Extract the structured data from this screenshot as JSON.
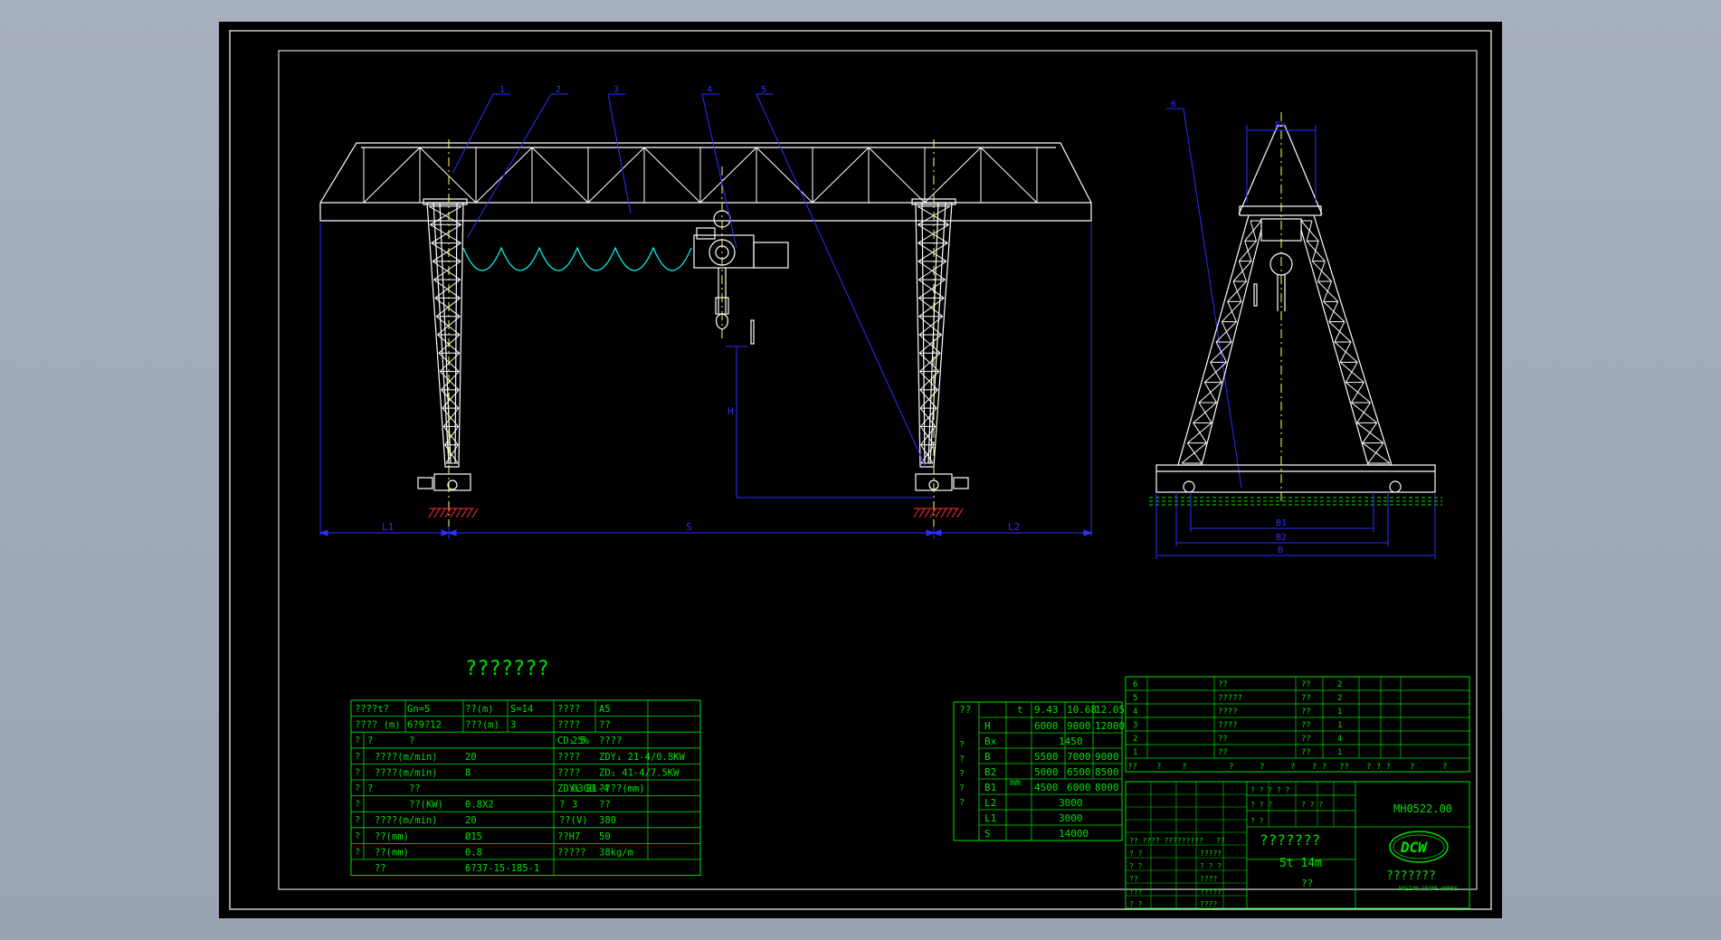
{
  "drawing": {
    "main_title": "???????",
    "part_number": "MH0522.00",
    "name": "???????",
    "spec": "5t  14m",
    "material": "??",
    "scale": "???????",
    "company_sub": "DALIAN CRANE WORKS",
    "logo_text": "DCW"
  },
  "balloons": [
    "1",
    "2",
    "3",
    "4",
    "5",
    "6"
  ],
  "dimensions": {
    "l1": "L1",
    "span": "S",
    "l2": "L2",
    "height": "H",
    "bx": "Bx",
    "b1": "B1",
    "b2": "B2",
    "b": "B"
  },
  "params": {
    "rows": [
      [
        "????t?",
        "Gn=5",
        "??(m)",
        "S=14",
        "????",
        "A5"
      ],
      [
        "???? (m)",
        "6?9?12",
        "???(m)",
        "3",
        "????",
        "??"
      ],
      [
        "?",
        "?",
        "CD₁ 5",
        "????",
        "25%"
      ],
      [
        "????(m/min)",
        "20",
        "????",
        "ZDY₁ 21-4/0.8KW"
      ],
      [
        "????(m/min)",
        "8",
        "????",
        "ZD₁ 41-4/7.5KW"
      ],
      [
        "?",
        "??",
        "ZDY₁ 21-4",
        "????(mm)",
        "Ø300"
      ],
      [
        "??(KW)",
        "0.8X2",
        "?",
        "??",
        "3"
      ],
      [
        "????(m/min)",
        "20",
        "??(V)",
        "380"
      ],
      [
        "??(mm)",
        "Ø15",
        "??H7",
        "50"
      ],
      [
        "??(mm)",
        "0.8",
        "?????",
        "38kg/m"
      ],
      [
        "??",
        "6?37-15-185-1"
      ]
    ],
    "side_labels": [
      "?",
      "?",
      "?",
      "?",
      "?",
      "?",
      "?",
      "?"
    ]
  },
  "dimtable": {
    "header": [
      "??",
      "t",
      "9.43",
      "10.68",
      "12.05"
    ],
    "side": "?????",
    "unit": "mm",
    "rows": [
      [
        "H",
        "6000",
        "9000",
        "12000"
      ],
      [
        "Bx",
        "1450"
      ],
      [
        "B",
        "5500",
        "7000",
        "9000"
      ],
      [
        "B2",
        "5000",
        "6500",
        "8500"
      ],
      [
        "B1",
        "4500",
        "6000",
        "8000"
      ],
      [
        "L2",
        "3000"
      ],
      [
        "L1",
        "3000"
      ],
      [
        "S",
        "14000"
      ]
    ]
  },
  "parts": [
    [
      "6",
      "??",
      "??",
      "2"
    ],
    [
      "5",
      "?????",
      "??",
      "2"
    ],
    [
      "4",
      "????",
      "??",
      "1"
    ],
    [
      "3",
      "????",
      "??",
      "1"
    ],
    [
      "2",
      "??",
      "??",
      "4"
    ],
    [
      "1",
      "??",
      "??",
      "1"
    ]
  ],
  "parts_header": [
    "??",
    "?",
    "?",
    "?",
    "?",
    "?",
    "? ?",
    "??",
    "? ? ?",
    "?",
    "?"
  ],
  "titleblock": {
    "left_rows": [
      "? ?",
      "? ?",
      "??",
      "???",
      "? ?"
    ],
    "left_vals": [
      "?????",
      "? ? ?",
      "????",
      "?????",
      "????"
    ],
    "row_mid": [
      "?? ??",
      "?? ??",
      "?????",
      "??",
      "??"
    ],
    "stage": "? ? ? ? ?",
    "weight": "? ? ?",
    "ratio": "? ? ?",
    "sheet": "? ?"
  },
  "colors": {
    "background": "#a6afbc",
    "sheet": "#000000",
    "structure": "#ffffff",
    "dimension": "#2e2eff",
    "table": "#00e000",
    "hoist_ref": "#ffff66",
    "ground": "#ff3030",
    "cable": "#00ffff"
  }
}
